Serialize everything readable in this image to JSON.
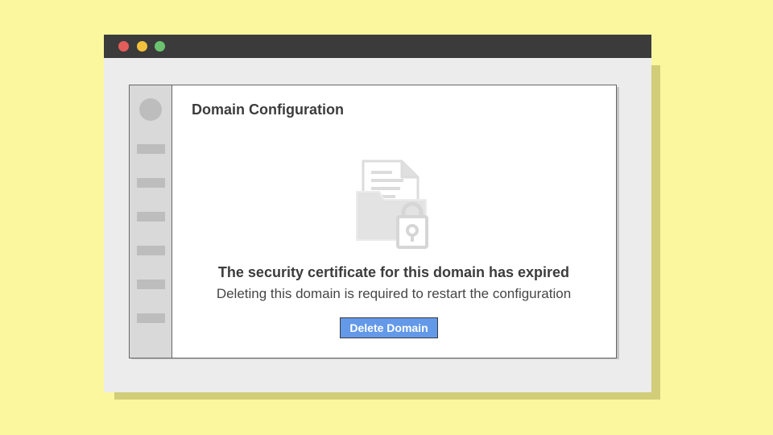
{
  "window": {
    "controls": [
      "close",
      "minimize",
      "maximize"
    ]
  },
  "sidebar": {
    "nav_items": 6
  },
  "page": {
    "title": "Domain Configuration"
  },
  "empty_state": {
    "icon": "locked-document-folder-icon",
    "headline": "The security certificate for this domain has expired",
    "message": "Deleting this domain is required to restart the configuration",
    "action_label": "Delete Domain"
  },
  "colors": {
    "background": "#fbf79f",
    "titlebar": "#3b3b3b",
    "button": "#6399e8",
    "close_dot": "#e35d5b",
    "minimize_dot": "#f4c13d",
    "maximize_dot": "#6cc36f"
  }
}
